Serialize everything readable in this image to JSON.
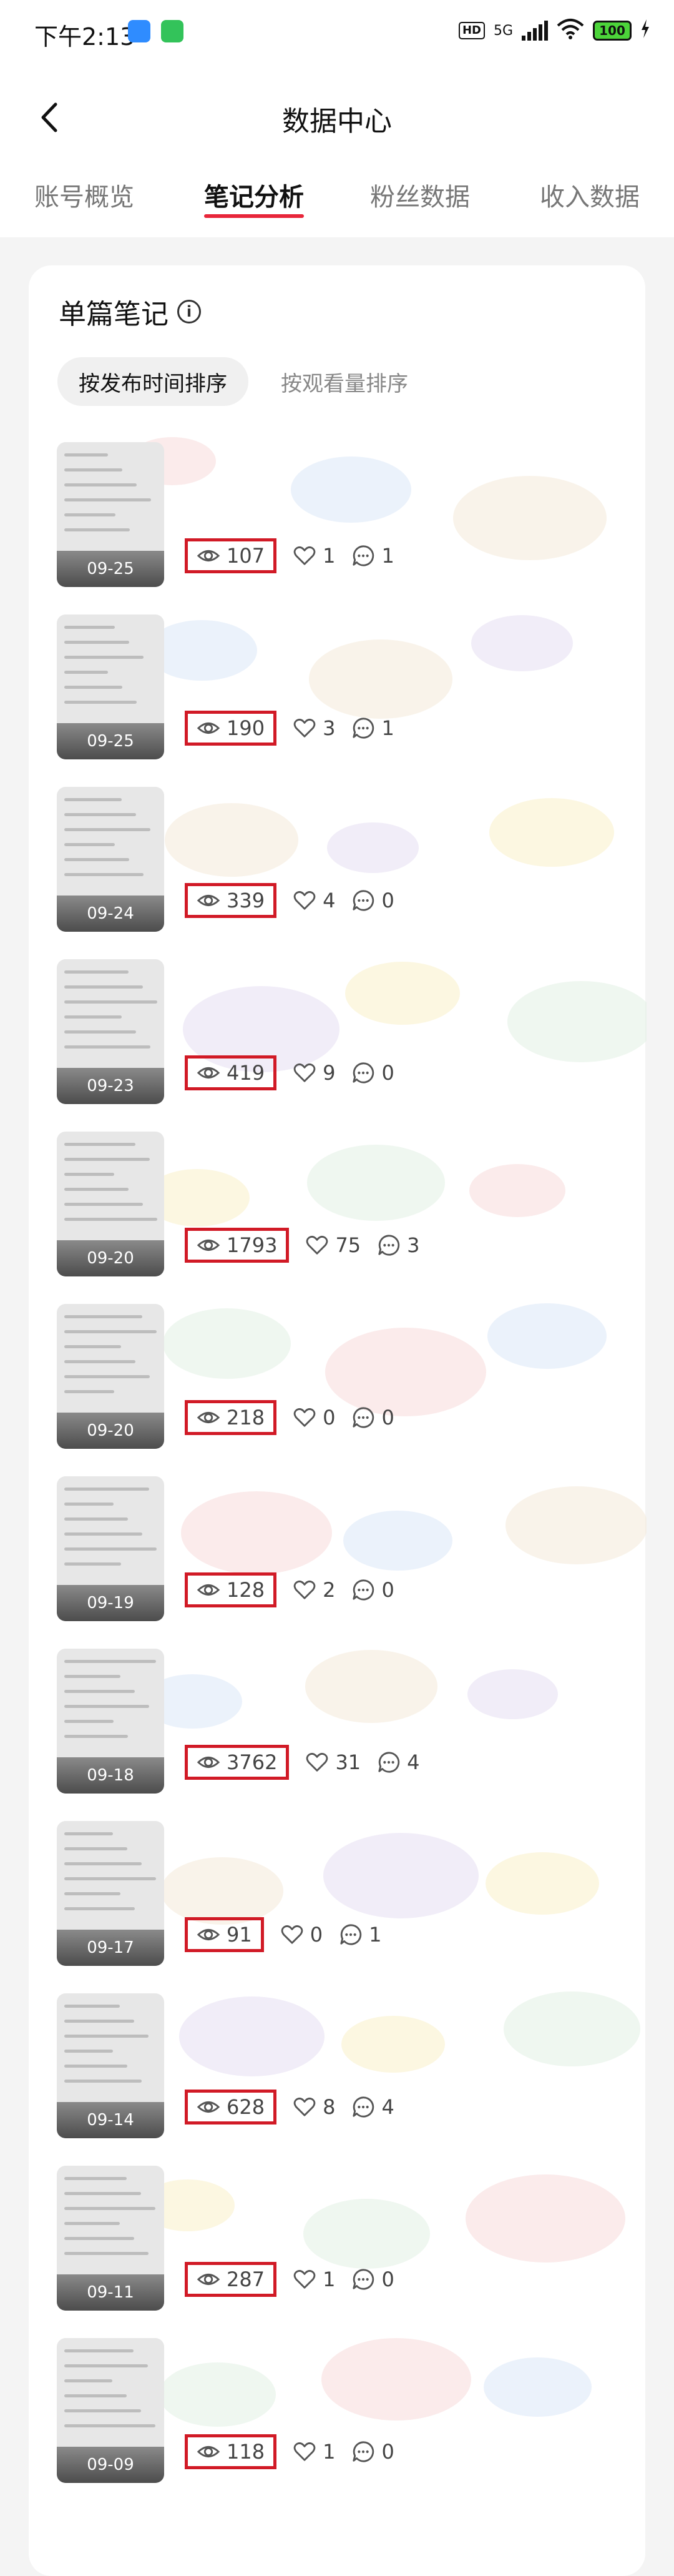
{
  "status_bar": {
    "time": "下午2:13",
    "hd": "HD",
    "network": "5G",
    "battery": "100"
  },
  "header": {
    "title": "数据中心",
    "tabs": [
      {
        "label": "账号概览"
      },
      {
        "label": "笔记分析"
      },
      {
        "label": "粉丝数据"
      },
      {
        "label": "收入数据"
      }
    ],
    "active_tab_index": 1
  },
  "section": {
    "title": "单篇笔记",
    "sort_options": [
      {
        "label": "按发布时间排序"
      },
      {
        "label": "按观看量排序"
      }
    ]
  },
  "notes": [
    {
      "date": "09-25",
      "views": "107",
      "likes": "1",
      "comments": "1"
    },
    {
      "date": "09-25",
      "views": "190",
      "likes": "3",
      "comments": "1"
    },
    {
      "date": "09-24",
      "views": "339",
      "likes": "4",
      "comments": "0"
    },
    {
      "date": "09-23",
      "views": "419",
      "likes": "9",
      "comments": "0"
    },
    {
      "date": "09-20",
      "views": "1793",
      "likes": "75",
      "comments": "3"
    },
    {
      "date": "09-20",
      "views": "218",
      "likes": "0",
      "comments": "0"
    },
    {
      "date": "09-19",
      "views": "128",
      "likes": "2",
      "comments": "0"
    },
    {
      "date": "09-18",
      "views": "3762",
      "likes": "31",
      "comments": "4"
    },
    {
      "date": "09-17",
      "views": "91",
      "likes": "0",
      "comments": "1"
    },
    {
      "date": "09-14",
      "views": "628",
      "likes": "8",
      "comments": "4"
    },
    {
      "date": "09-11",
      "views": "287",
      "likes": "1",
      "comments": "0"
    },
    {
      "date": "09-09",
      "views": "118",
      "likes": "1",
      "comments": "0"
    }
  ],
  "colors": {
    "accent": "#e8263a",
    "highlight_box": "#d11a26"
  }
}
